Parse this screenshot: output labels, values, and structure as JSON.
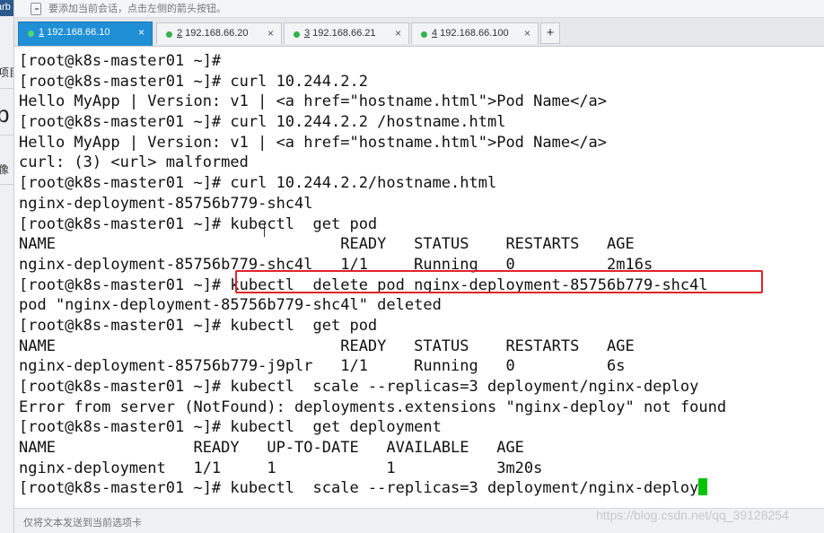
{
  "left_strip": {
    "top_text": "arb",
    "fragments": [
      "项目",
      "b",
      "像"
    ]
  },
  "notice": {
    "text": "要添加当前会话，点击左侧的箭头按钮。"
  },
  "tabs": [
    {
      "number": "1",
      "label": " 192.168.66.10",
      "active": true,
      "close": "×"
    },
    {
      "number": "2",
      "label": " 192.168.66.20",
      "active": false,
      "close": "×"
    },
    {
      "number": "3",
      "label": " 192.168.66.21",
      "active": false,
      "close": "×"
    },
    {
      "number": "4",
      "label": " 192.168.66.100",
      "active": false,
      "close": "×"
    }
  ],
  "tab_add_label": "+",
  "terminal": {
    "lines": [
      "[root@k8s-master01 ~]#",
      "[root@k8s-master01 ~]# curl 10.244.2.2",
      "Hello MyApp | Version: v1 | <a href=\"hostname.html\">Pod Name</a>",
      "[root@k8s-master01 ~]# curl 10.244.2.2 /hostname.html",
      "Hello MyApp | Version: v1 | <a href=\"hostname.html\">Pod Name</a>",
      "curl: (3) <url> malformed",
      "[root@k8s-master01 ~]# curl 10.244.2.2/hostname.html",
      "nginx-deployment-85756b779-shc4l",
      "[root@k8s-master01 ~]# kubectl  get pod",
      "NAME                               READY   STATUS    RESTARTS   AGE",
      "nginx-deployment-85756b779-shc4l   1/1     Running   0          2m16s",
      "[root@k8s-master01 ~]# kubectl  delete pod nginx-deployment-85756b779-shc4l",
      "pod \"nginx-deployment-85756b779-shc4l\" deleted",
      "[root@k8s-master01 ~]# kubectl  get pod",
      "NAME                               READY   STATUS    RESTARTS   AGE",
      "nginx-deployment-85756b779-j9plr   1/1     Running   0          6s",
      "[root@k8s-master01 ~]# kubectl  scale --replicas=3 deployment/nginx-deploy",
      "Error from server (NotFound): deployments.extensions \"nginx-deploy\" not found",
      "[root@k8s-master01 ~]# kubectl  get deployment",
      "NAME               READY   UP-TO-DATE   AVAILABLE   AGE",
      "nginx-deployment   1/1     1            1           3m20s",
      "[root@k8s-master01 ~]# kubectl  scale --replicas=3 deployment/nginx-deploy"
    ],
    "cursor_color": "#00c400",
    "highlight_color": "#e0242b"
  },
  "bottom": {
    "hint": "仅将文本发送到当前选项卡",
    "watermark": "https://blog.csdn.net/qq_39128254"
  },
  "colors": {
    "active_tab": "#1f8fd6",
    "status_dot": "#2fb34a"
  }
}
